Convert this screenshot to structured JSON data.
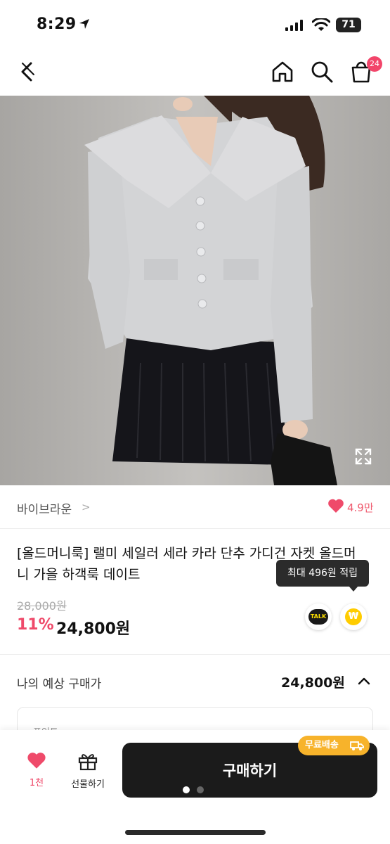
{
  "status_bar": {
    "time": "8:29",
    "battery": "71"
  },
  "nav": {
    "cart_count": "24"
  },
  "product_image": {
    "carousel_total": 5,
    "carousel_active_index": 1
  },
  "seller": {
    "name": "바이브라운",
    "chevron": ">",
    "likes": "4.9만"
  },
  "product": {
    "title": "[올드머니룩] 랠미 세일러 세라 카라 단추 가디건 자켓 올드머니 가을 하객룩 데이트",
    "points_tooltip": "최대 496원 적립",
    "original_price": "28,000원",
    "discount_rate": "11%",
    "sale_price": "24,800원",
    "talk_label": "TALK",
    "points_symbol": "₩"
  },
  "expected_price": {
    "label": "나의 예상 구매가",
    "value": "24,800원"
  },
  "points_card": {
    "label": "포인트"
  },
  "bottom_bar": {
    "like_label": "1천",
    "gift_label": "선물하기",
    "buy_label": "구매하기",
    "free_shipping": "무료배송"
  },
  "colors": {
    "accent_pink": "#ef4a6a",
    "buy_button": "#1b1b1b",
    "free_shipping": "#f7b32b",
    "badge": "#f2456a"
  }
}
